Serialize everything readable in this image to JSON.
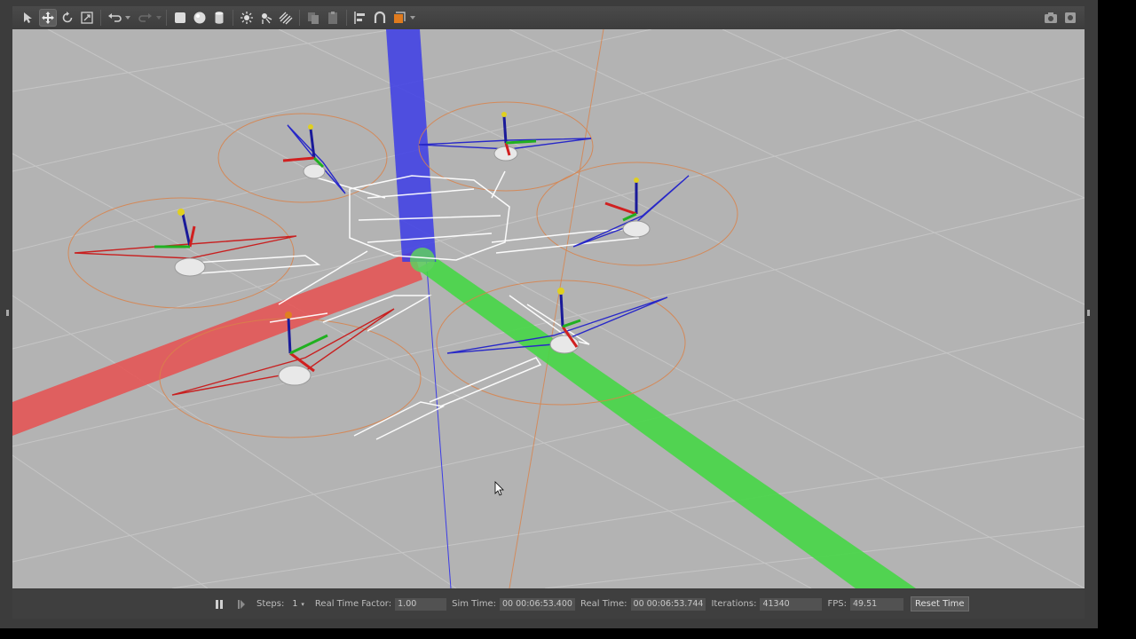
{
  "status": {
    "steps_label": "Steps:",
    "steps_value": "1",
    "rtf_label": "Real Time Factor:",
    "rtf_value": "1.00",
    "sim_time_label": "Sim Time:",
    "sim_time_value": "00 00:06:53.400",
    "real_time_label": "Real Time:",
    "real_time_value": "00 00:06:53.744",
    "iterations_label": "Iterations:",
    "iterations_value": "41340",
    "fps_label": "FPS:",
    "fps_value": "49.51",
    "reset_label": "Reset Time"
  },
  "toolbar": {
    "icons": [
      "select-arrow-icon",
      "translate-icon",
      "rotate-icon",
      "scale-icon",
      "undo-icon",
      "redo-icon",
      "box-shape-icon",
      "sphere-shape-icon",
      "cylinder-shape-icon",
      "point-light-icon",
      "spot-light-icon",
      "directional-light-icon",
      "copy-icon",
      "paste-icon",
      "align-icon",
      "snap-icon",
      "view-angle-icon",
      "screenshot-icon",
      "record-icon"
    ],
    "active_tool": "translate"
  },
  "colors": {
    "viewport_bg": "#b3b3b3",
    "x_axis": "#e65050",
    "y_axis": "#46d646",
    "z_axis": "#3c3ce6",
    "rotor_disk": "#d9824a",
    "accent_orange": "#e07b1e"
  }
}
